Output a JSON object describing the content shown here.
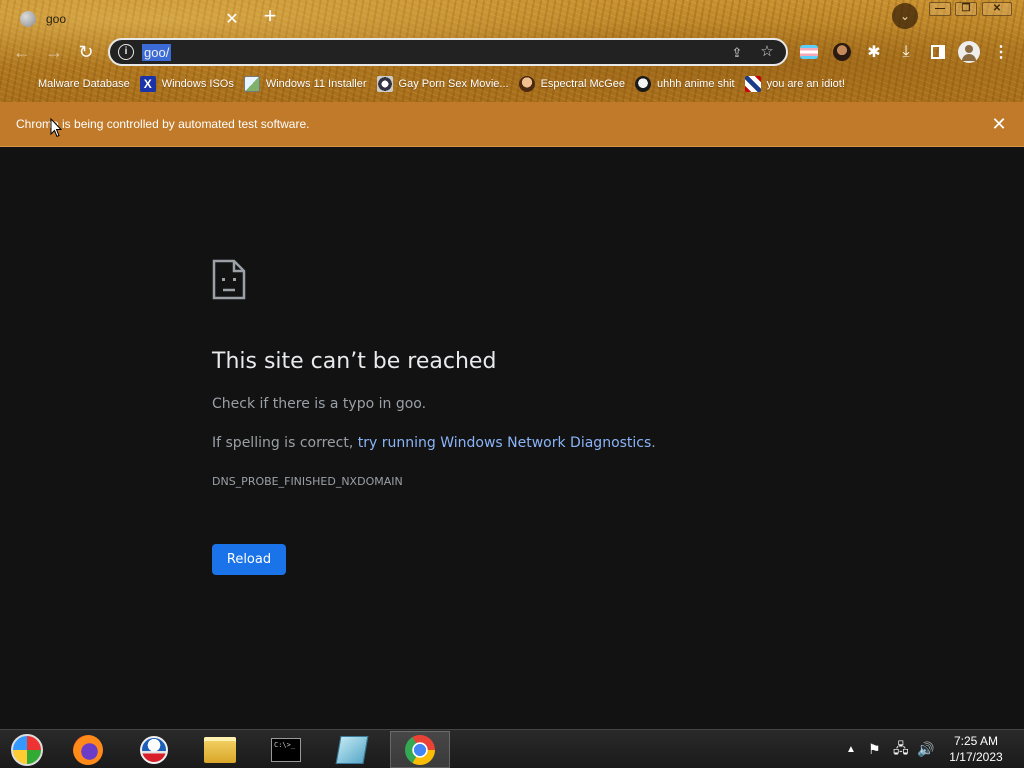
{
  "tab": {
    "title": "goo",
    "close_symbol": "✕",
    "new_tab_symbol": "+",
    "favicon": "globe-icon"
  },
  "window": {
    "minimize_symbol": "—",
    "maximize_symbol": "❐",
    "close_symbol": "✕"
  },
  "toolbar": {
    "back_symbol": "←",
    "forward_symbol": "→",
    "reload_symbol": "↻",
    "address_value": "goo/",
    "info_symbol": "i",
    "share_symbol": "⇪",
    "bookmark_symbol": "☆",
    "extensions_symbol": "✱",
    "download_symbol": "⤓",
    "menu_symbol": "⋮"
  },
  "bookmarks": [
    {
      "label": "Malware Database"
    },
    {
      "label": "Windows ISOs",
      "icon_text": "X"
    },
    {
      "label": "Windows 11 Installer"
    },
    {
      "label": "Gay Porn Sex Movie..."
    },
    {
      "label": "Espectral McGee"
    },
    {
      "label": "uhhh anime shit"
    },
    {
      "label": "you are an idiot!"
    }
  ],
  "infobar": {
    "text": "Chrome is being controlled by automated test software.",
    "close_symbol": "✕"
  },
  "error_page": {
    "title": "This site can’t be reached",
    "line1": "Check if there is a typo in goo.",
    "line2_prefix": "If spelling is correct, ",
    "line2_link": "try running Windows Network Diagnostics",
    "line2_suffix": ".",
    "error_code": "DNS_PROBE_FINISHED_NXDOMAIN",
    "reload_label": "Reload"
  },
  "taskbar": {
    "cmd_text": "C:\\>_",
    "tray_arrow": "▲",
    "tray_flag": "⚑",
    "tray_network": "🖧",
    "tray_volume": "🔊",
    "time": "7:25 AM",
    "date": "1/17/2023"
  },
  "colors": {
    "accent": "#1a73e8",
    "link": "#8ab4f8",
    "infobar": "#c07a2a",
    "page_background": "#121212"
  }
}
